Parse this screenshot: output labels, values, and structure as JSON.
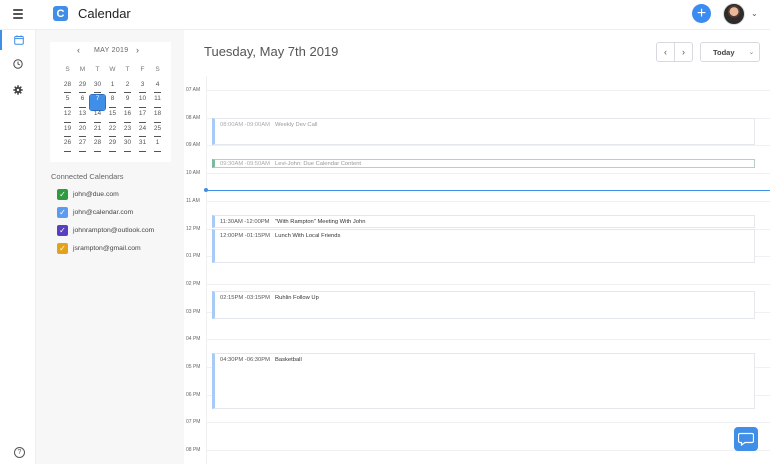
{
  "app": {
    "title": "Calendar",
    "logo_letter": "C"
  },
  "header": {
    "add_label": "+",
    "avatar_caret": "⌄"
  },
  "mini_calendar": {
    "prev": "‹",
    "next": "›",
    "title": "MAY 2019",
    "weekdays": [
      "S",
      "M",
      "T",
      "W",
      "T",
      "F",
      "S"
    ],
    "weeks": [
      [
        "28",
        "29",
        "30",
        "1",
        "2",
        "3",
        "4"
      ],
      [
        "5",
        "6",
        "7",
        "8",
        "9",
        "10",
        "11"
      ],
      [
        "12",
        "13",
        "14",
        "15",
        "16",
        "17",
        "18"
      ],
      [
        "19",
        "20",
        "21",
        "22",
        "23",
        "24",
        "25"
      ],
      [
        "26",
        "27",
        "28",
        "29",
        "30",
        "31",
        "1"
      ]
    ],
    "selected": "7"
  },
  "connected": {
    "title": "Connected Calendars",
    "items": [
      {
        "label": "john@due.com",
        "color": "#2e9b3e"
      },
      {
        "label": "john@calendar.com",
        "color": "#5b9cf0"
      },
      {
        "label": "johnrampton@outlook.com",
        "color": "#5a3fc0"
      },
      {
        "label": "jsrampton@gmail.com",
        "color": "#e3a21a"
      }
    ]
  },
  "main": {
    "date_title": "Tuesday, May 7th 2019",
    "nav_prev": "‹",
    "nav_next": "›",
    "today_label": "Today",
    "today_caret": "⌄"
  },
  "hours": [
    "07 AM",
    "08 AM",
    "09 AM",
    "10 AM",
    "11 AM",
    "12 PM",
    "01 PM",
    "02 PM",
    "03 PM",
    "04 PM",
    "05 PM",
    "06 PM",
    "07 PM",
    "08 PM"
  ],
  "events": [
    {
      "time": "08:00AM -09:00AM",
      "title": "Weekly Dev Call"
    },
    {
      "time": "09:30AM -09:50AM",
      "title": "Levi-John: Due Calendar Content"
    },
    {
      "time": "11:30AM -12:00PM",
      "title": "\"With Rampton\" Meeting With John"
    },
    {
      "time": "12:00PM -01:15PM",
      "title": "Lunch With Local Friends"
    },
    {
      "time": "02:15PM -03:15PM",
      "title": "Ruhlin Follow Up"
    },
    {
      "time": "04:30PM -06:30PM",
      "title": "Basketball"
    }
  ]
}
